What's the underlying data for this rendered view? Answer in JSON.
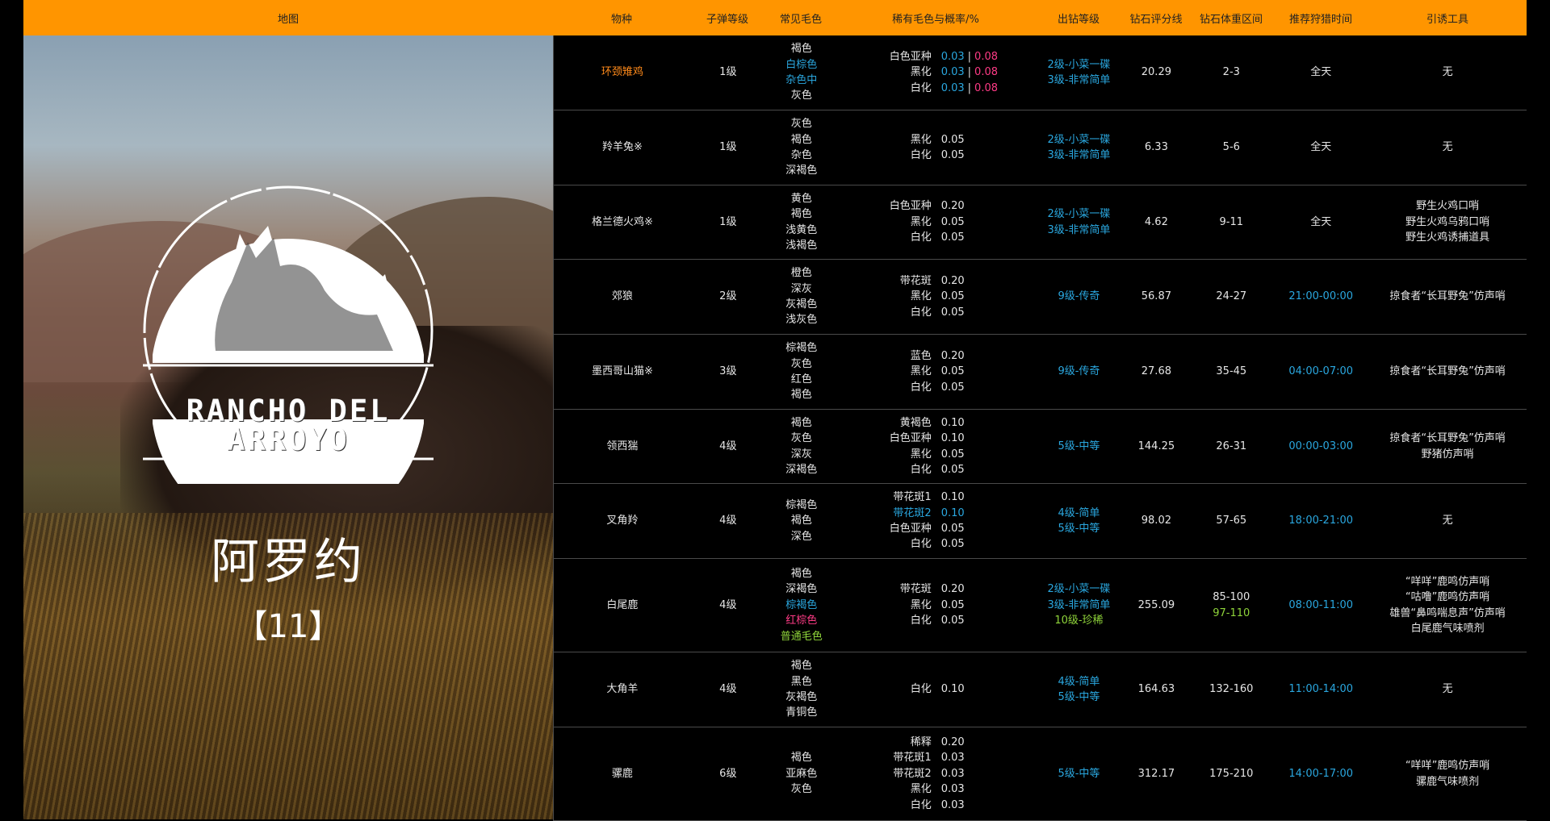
{
  "header": {
    "map": "地图",
    "species": "物种",
    "ammo": "子弹等级",
    "common_fur": "常见毛色",
    "rare_fur": "稀有毛色与概率/%",
    "class": "出钻等级",
    "diamond_score": "钻石评分线",
    "diamond_weight": "钻石体重区间",
    "best_time": "推荐狩猎时间",
    "lure": "引诱工具"
  },
  "map_panel": {
    "logo_line1": "RANCHO DEL",
    "logo_line2": "ARROYO",
    "map_name": "阿罗约",
    "count": "【11】"
  },
  "colors": {
    "header_bg": "#ff9500",
    "blue": "#2aa7df",
    "pink": "#ff3b86",
    "orange": "#ff8a1a",
    "green": "#8fd43a"
  },
  "rows": [
    {
      "species": "环颈雉鸡",
      "species_color": "orange",
      "ammo": "1级",
      "fur": [
        {
          "t": "褐色"
        },
        {
          "t": "白棕色",
          "c": "blue"
        },
        {
          "t": "杂色中",
          "c": "blue"
        },
        {
          "t": "灰色"
        }
      ],
      "rare": [
        {
          "name": "白色亚种",
          "v1": "0.03",
          "v2": "0.08"
        },
        {
          "name": "黑化",
          "v1": "0.03",
          "v2": "0.08"
        },
        {
          "name": "白化",
          "v1": "0.03",
          "v2": "0.08"
        }
      ],
      "class": [
        {
          "t": "2级-小菜一碟",
          "c": "blue"
        },
        {
          "t": "3级-非常简单",
          "c": "blue"
        }
      ],
      "score": "20.29",
      "weight": [
        {
          "t": "2-3"
        }
      ],
      "time": {
        "t": "全天"
      },
      "lure": [
        {
          "t": "无"
        }
      ]
    },
    {
      "species": "羚羊兔※",
      "ammo": "1级",
      "fur": [
        {
          "t": "灰色"
        },
        {
          "t": "褐色"
        },
        {
          "t": "杂色"
        },
        {
          "t": "深褐色"
        }
      ],
      "rare": [
        {
          "name": "黑化",
          "v": "0.05"
        },
        {
          "name": "白化",
          "v": "0.05"
        }
      ],
      "class": [
        {
          "t": "2级-小菜一碟",
          "c": "blue"
        },
        {
          "t": "3级-非常简单",
          "c": "blue"
        }
      ],
      "score": "6.33",
      "weight": [
        {
          "t": "5-6"
        }
      ],
      "time": {
        "t": "全天"
      },
      "lure": [
        {
          "t": "无"
        }
      ]
    },
    {
      "species": "格兰德火鸡※",
      "ammo": "1级",
      "fur": [
        {
          "t": "黄色"
        },
        {
          "t": "褐色"
        },
        {
          "t": "浅黄色"
        },
        {
          "t": "浅褐色"
        }
      ],
      "rare": [
        {
          "name": "白色亚种",
          "v": "0.20"
        },
        {
          "name": "黑化",
          "v": "0.05"
        },
        {
          "name": "白化",
          "v": "0.05"
        }
      ],
      "class": [
        {
          "t": "2级-小菜一碟",
          "c": "blue"
        },
        {
          "t": "3级-非常简单",
          "c": "blue"
        }
      ],
      "score": "4.62",
      "weight": [
        {
          "t": "9-11"
        }
      ],
      "time": {
        "t": "全天"
      },
      "lure": [
        {
          "t": "野生火鸡口哨"
        },
        {
          "t": "野生火鸡乌鸦口哨"
        },
        {
          "t": "野生火鸡诱捕道具"
        }
      ]
    },
    {
      "species": "郊狼",
      "ammo": "2级",
      "fur": [
        {
          "t": "橙色"
        },
        {
          "t": "深灰"
        },
        {
          "t": "灰褐色"
        },
        {
          "t": "浅灰色"
        }
      ],
      "rare": [
        {
          "name": "带花斑",
          "v": "0.20"
        },
        {
          "name": "黑化",
          "v": "0.05"
        },
        {
          "name": "白化",
          "v": "0.05"
        }
      ],
      "class": [
        {
          "t": "9级-传奇",
          "c": "blue"
        }
      ],
      "score": "56.87",
      "weight": [
        {
          "t": "24-27"
        }
      ],
      "time": {
        "t": "21:00-00:00",
        "c": "blue"
      },
      "lure": [
        {
          "t": "掠食者“长耳野兔”仿声哨"
        }
      ]
    },
    {
      "species": "墨西哥山猫※",
      "ammo": "3级",
      "fur": [
        {
          "t": "棕褐色"
        },
        {
          "t": "灰色"
        },
        {
          "t": "红色"
        },
        {
          "t": "褐色"
        }
      ],
      "rare": [
        {
          "name": "蓝色",
          "v": "0.20"
        },
        {
          "name": "黑化",
          "v": "0.05"
        },
        {
          "name": "白化",
          "v": "0.05"
        }
      ],
      "class": [
        {
          "t": "9级-传奇",
          "c": "blue"
        }
      ],
      "score": "27.68",
      "weight": [
        {
          "t": "35-45"
        }
      ],
      "time": {
        "t": "04:00-07:00",
        "c": "blue"
      },
      "lure": [
        {
          "t": "掠食者“长耳野兔”仿声哨"
        }
      ]
    },
    {
      "species": "领西猯",
      "ammo": "4级",
      "fur": [
        {
          "t": "褐色"
        },
        {
          "t": "灰色"
        },
        {
          "t": "深灰"
        },
        {
          "t": "深褐色"
        }
      ],
      "rare": [
        {
          "name": "黄褐色",
          "v": "0.10"
        },
        {
          "name": "白色亚种",
          "v": "0.10"
        },
        {
          "name": "黑化",
          "v": "0.05"
        },
        {
          "name": "白化",
          "v": "0.05"
        }
      ],
      "class": [
        {
          "t": "5级-中等",
          "c": "blue"
        }
      ],
      "score": "144.25",
      "weight": [
        {
          "t": "26-31"
        }
      ],
      "time": {
        "t": "00:00-03:00",
        "c": "blue"
      },
      "lure": [
        {
          "t": "掠食者“长耳野兔”仿声哨"
        },
        {
          "t": "野猪仿声哨"
        }
      ]
    },
    {
      "species": "叉角羚",
      "ammo": "4级",
      "fur": [
        {
          "t": "棕褐色"
        },
        {
          "t": "褐色"
        },
        {
          "t": "深色"
        }
      ],
      "rare": [
        {
          "name": "带花斑1",
          "v": "0.10"
        },
        {
          "name": "带花斑2",
          "v": "0.10",
          "c": "blue"
        },
        {
          "name": "白色亚种",
          "v": "0.05"
        },
        {
          "name": "白化",
          "v": "0.05"
        }
      ],
      "class": [
        {
          "t": "4级-简单",
          "c": "blue"
        },
        {
          "t": "5级-中等",
          "c": "blue"
        }
      ],
      "score": "98.02",
      "weight": [
        {
          "t": "57-65"
        }
      ],
      "time": {
        "t": "18:00-21:00",
        "c": "blue"
      },
      "lure": [
        {
          "t": "无"
        }
      ]
    },
    {
      "species": "白尾鹿",
      "ammo": "4级",
      "fur": [
        {
          "t": "褐色"
        },
        {
          "t": "深褐色"
        },
        {
          "t": "棕褐色",
          "c": "blue"
        },
        {
          "t": "红棕色",
          "c": "pink"
        },
        {
          "t": "普通毛色",
          "c": "green"
        }
      ],
      "rare": [
        {
          "name": "带花斑",
          "v": "0.20"
        },
        {
          "name": "黑化",
          "v": "0.05"
        },
        {
          "name": "白化",
          "v": "0.05"
        }
      ],
      "class": [
        {
          "t": "2级-小菜一碟",
          "c": "blue"
        },
        {
          "t": "3级-非常简单",
          "c": "blue"
        },
        {
          "t": "10级-珍稀",
          "c": "green"
        }
      ],
      "score": "255.09",
      "weight": [
        {
          "t": "85-100"
        },
        {
          "t": "97-110",
          "c": "green"
        }
      ],
      "time": {
        "t": "08:00-11:00",
        "c": "blue"
      },
      "lure": [
        {
          "t": "“咩咩”鹿鸣仿声哨"
        },
        {
          "t": "“咕噜”鹿鸣仿声哨"
        },
        {
          "t": "雄兽“鼻鸣喘息声”仿声哨"
        },
        {
          "t": "白尾鹿气味喷剂"
        }
      ]
    },
    {
      "species": "大角羊",
      "ammo": "4级",
      "fur": [
        {
          "t": "褐色"
        },
        {
          "t": "黑色"
        },
        {
          "t": "灰褐色"
        },
        {
          "t": "青铜色"
        }
      ],
      "rare": [
        {
          "name": "白化",
          "v": "0.10"
        }
      ],
      "class": [
        {
          "t": "4级-简单",
          "c": "blue"
        },
        {
          "t": "5级-中等",
          "c": "blue"
        }
      ],
      "score": "164.63",
      "weight": [
        {
          "t": "132-160"
        }
      ],
      "time": {
        "t": "11:00-14:00",
        "c": "blue"
      },
      "lure": [
        {
          "t": "无"
        }
      ]
    },
    {
      "species": "骡鹿",
      "ammo": "6级",
      "fur": [
        {
          "t": "褐色"
        },
        {
          "t": "亚麻色"
        },
        {
          "t": "灰色"
        }
      ],
      "rare": [
        {
          "name": "稀释",
          "v": "0.20"
        },
        {
          "name": "带花斑1",
          "v": "0.03"
        },
        {
          "name": "带花斑2",
          "v": "0.03"
        },
        {
          "name": "黑化",
          "v": "0.03"
        },
        {
          "name": "白化",
          "v": "0.03"
        }
      ],
      "class": [
        {
          "t": "5级-中等",
          "c": "blue"
        }
      ],
      "score": "312.17",
      "weight": [
        {
          "t": "175-210"
        }
      ],
      "time": {
        "t": "14:00-17:00",
        "c": "blue"
      },
      "lure": [
        {
          "t": "“咩咩”鹿鸣仿声哨"
        },
        {
          "t": "骡鹿气味喷剂"
        }
      ]
    }
  ]
}
